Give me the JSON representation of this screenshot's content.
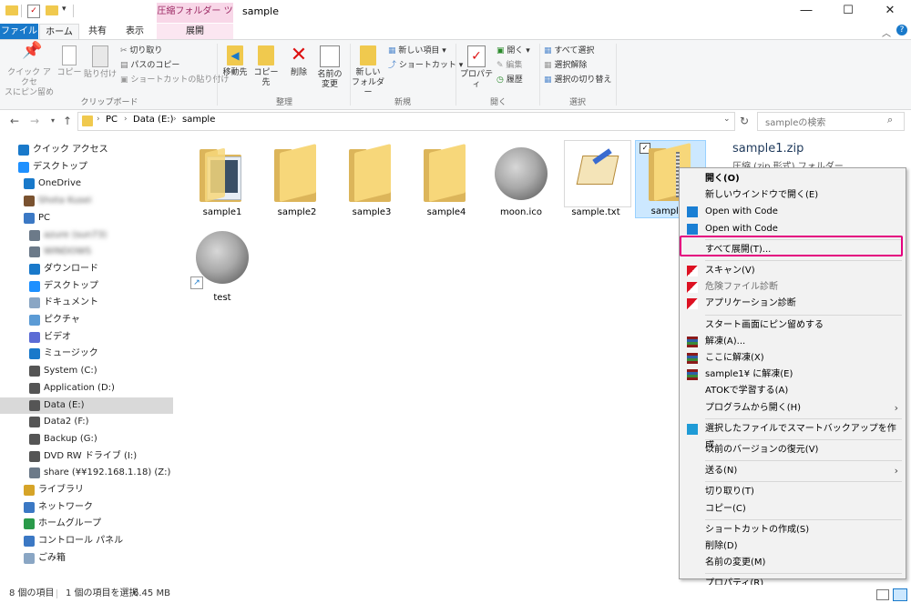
{
  "titlebar": {
    "context_tool": "圧縮フォルダー ツール",
    "window_title": "sample"
  },
  "tabs": {
    "file": "ファイル",
    "home": "ホーム",
    "share": "共有",
    "view": "表示",
    "extract": "展開"
  },
  "ribbon": {
    "pin_quick_access": [
      "クイック アクセ",
      "スにピン留め"
    ],
    "copy": "コピー",
    "paste": "貼り付け",
    "cut": "切り取り",
    "copy_path": "パスのコピー",
    "paste_shortcut": "ショートカットの貼り付け",
    "group_clipboard": "クリップボード",
    "move_to": "移動先",
    "copy_to": "コピー先",
    "delete": "削除",
    "rename": [
      "名前の",
      "変更"
    ],
    "group_organize": "整理",
    "new_folder": [
      "新しい",
      "フォルダー"
    ],
    "new_item": "新しい項目",
    "shortcut": "ショートカット",
    "group_new": "新規",
    "properties": "プロパティ",
    "open": "開く",
    "edit": "編集",
    "history": "履歴",
    "group_open": "開く",
    "select_all": "すべて選択",
    "select_none": "選択解除",
    "invert_selection": "選択の切り替え",
    "group_select": "選択"
  },
  "address": {
    "path": [
      "PC",
      "Data (E:)",
      "sample"
    ],
    "search_placeholder": "sampleの検索"
  },
  "navpane": [
    {
      "label": "クイック アクセス",
      "icon": "star-icon",
      "indent": 0
    },
    {
      "label": "デスクトップ",
      "icon": "desktop-icon",
      "indent": 0
    },
    {
      "label": "OneDrive",
      "icon": "cloud-icon",
      "indent": 1
    },
    {
      "label": "Shota Kusei",
      "icon": "user-icon",
      "indent": 1,
      "blurred": true
    },
    {
      "label": "PC",
      "icon": "pc-icon",
      "indent": 1
    },
    {
      "label": "azure (sun73)",
      "icon": "network-drive-icon",
      "indent": 2,
      "blurred": true
    },
    {
      "label": "WINDOWS",
      "icon": "network-drive-icon",
      "indent": 2,
      "blurred": true
    },
    {
      "label": "ダウンロード",
      "icon": "download-icon",
      "indent": 2
    },
    {
      "label": "デスクトップ",
      "icon": "desktop-icon",
      "indent": 2
    },
    {
      "label": "ドキュメント",
      "icon": "document-icon",
      "indent": 2
    },
    {
      "label": "ピクチャ",
      "icon": "picture-icon",
      "indent": 2
    },
    {
      "label": "ビデオ",
      "icon": "video-icon",
      "indent": 2
    },
    {
      "label": "ミュージック",
      "icon": "music-icon",
      "indent": 2
    },
    {
      "label": "System (C:)",
      "icon": "drive-icon",
      "indent": 2
    },
    {
      "label": "Application (D:)",
      "icon": "drive-icon",
      "indent": 2
    },
    {
      "label": "Data (E:)",
      "icon": "drive-icon",
      "indent": 2,
      "selected": true
    },
    {
      "label": "Data2 (F:)",
      "icon": "drive-icon",
      "indent": 2
    },
    {
      "label": "Backup (G:)",
      "icon": "drive-icon",
      "indent": 2
    },
    {
      "label": "DVD RW ドライブ (I:)",
      "icon": "dvd-icon",
      "indent": 2
    },
    {
      "label": "share (¥¥192.168.1.18) (Z:)",
      "icon": "network-drive-icon",
      "indent": 2
    },
    {
      "label": "ライブラリ",
      "icon": "library-icon",
      "indent": 1
    },
    {
      "label": "ネットワーク",
      "icon": "network-icon",
      "indent": 1
    },
    {
      "label": "ホームグループ",
      "icon": "homegroup-icon",
      "indent": 1
    },
    {
      "label": "コントロール パネル",
      "icon": "control-panel-icon",
      "indent": 1
    },
    {
      "label": "ごみ箱",
      "icon": "recycle-bin-icon",
      "indent": 1
    }
  ],
  "files": [
    {
      "name": "sample1",
      "kind": "folder-photo"
    },
    {
      "name": "sample2",
      "kind": "folder"
    },
    {
      "name": "sample3",
      "kind": "folder"
    },
    {
      "name": "sample4",
      "kind": "folder"
    },
    {
      "name": "moon.ico",
      "kind": "moon"
    },
    {
      "name": "sample.txt",
      "kind": "text"
    },
    {
      "name": "sample1",
      "kind": "zip",
      "selected": true
    },
    {
      "name": "test",
      "kind": "moon-shortcut"
    }
  ],
  "details": {
    "filename": "sample1.zip",
    "type": "圧縮 (zip 形式) フォルダー"
  },
  "context_menu": [
    {
      "label": "開く(O)",
      "bold": true
    },
    {
      "label": "新しいウインドウで開く(E)"
    },
    {
      "label": "Open with Code",
      "icon": "vscode-icon"
    },
    {
      "label": "Open with Code",
      "icon": "vscode-icon"
    },
    {
      "sep": true
    },
    {
      "label": "すべて展開(T)...",
      "highlighted": true
    },
    {
      "sep": true
    },
    {
      "label": "スキャン(V)",
      "icon": "antivirus-icon"
    },
    {
      "label": "危険ファイル診断",
      "icon": "antivirus-icon",
      "dim": true
    },
    {
      "label": "アプリケーション診断",
      "icon": "antivirus-icon"
    },
    {
      "sep": true
    },
    {
      "label": "スタート画面にピン留めする"
    },
    {
      "label": "解凍(A)...",
      "icon": "winrar-icon"
    },
    {
      "label": "ここに解凍(X)",
      "icon": "winrar-icon"
    },
    {
      "label": "sample1¥ に解凍(E)",
      "icon": "winrar-icon"
    },
    {
      "label": "ATOKで学習する(A)"
    },
    {
      "label": "プログラムから開く(H)",
      "submenu": true
    },
    {
      "sep": true
    },
    {
      "label": "選択したファイルでスマートバックアップを作成",
      "icon": "backup-icon"
    },
    {
      "sep": true
    },
    {
      "label": "以前のバージョンの復元(V)"
    },
    {
      "sep": true
    },
    {
      "label": "送る(N)",
      "submenu": true
    },
    {
      "sep": true
    },
    {
      "label": "切り取り(T)"
    },
    {
      "label": "コピー(C)"
    },
    {
      "sep": true
    },
    {
      "label": "ショートカットの作成(S)"
    },
    {
      "label": "削除(D)"
    },
    {
      "label": "名前の変更(M)"
    },
    {
      "sep": true
    },
    {
      "label": "プロパティ(R)"
    }
  ],
  "status": {
    "item_count": "8 個の項目",
    "selected_info": "1 個の項目を選択",
    "size": "6.45 MB"
  },
  "colors": {
    "accent": "#1979ca",
    "context_tab": "#f8d7e8",
    "highlight_border": "#e4007f",
    "selection": "#cce8ff"
  }
}
